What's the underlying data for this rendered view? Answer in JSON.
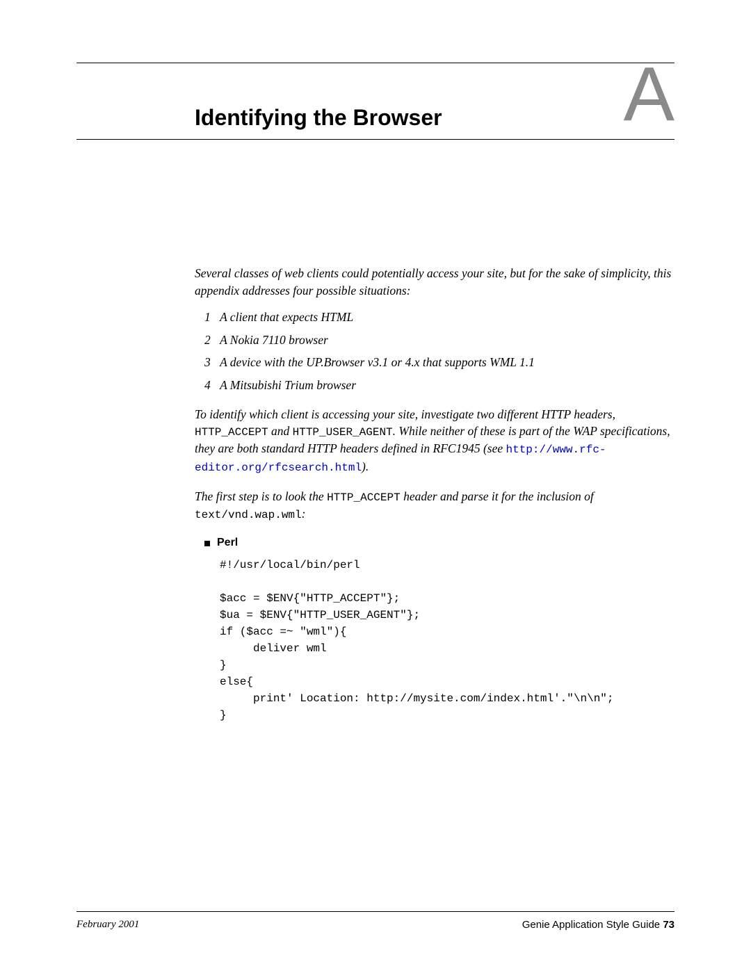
{
  "appendix_letter": "A",
  "chapter_title": "Identifying the Browser",
  "intro": "Several classes of web clients could potentially access your site, but for the sake of simplicity, this appendix addresses four possible situations:",
  "list": [
    "A client that expects HTML",
    "A Nokia 7110 browser",
    "A device with the UP.Browser v3.1 or 4.x that supports WML 1.1",
    "A Mitsubishi Trium browser"
  ],
  "para1_a": "To identify which client is accessing your site, investigate two different HTTP headers, ",
  "para1_mono1": "HTTP_ACCEPT",
  "para1_b": " and ",
  "para1_mono2": "HTTP_USER_AGENT",
  "para1_c": ". While neither of these is part of the WAP specifications, they are both standard HTTP headers defined in RFC1945 (see ",
  "para1_link": "http://www.rfc-editor.org/rfcsearch.html",
  "para1_d": ").",
  "para2_a": "The first step is to look the ",
  "para2_mono": "HTTP_ACCEPT",
  "para2_b": " header and parse it for the inclusion of ",
  "para2_mono2": "text/vnd.wap.wml",
  "para2_c": ":",
  "perl_label": "Perl",
  "code": "#!/usr/local/bin/perl\n\n$acc = $ENV{\"HTTP_ACCEPT\"};\n$ua = $ENV{\"HTTP_USER_AGENT\"};\nif ($acc =~ \"wml\"){\n     deliver wml\n}\nelse{\n     print' Location: http://mysite.com/index.html'.\"\\n\\n\";\n}",
  "footer_left": "February 2001",
  "footer_right_text": "Genie Application Style Guide ",
  "footer_page": "73"
}
